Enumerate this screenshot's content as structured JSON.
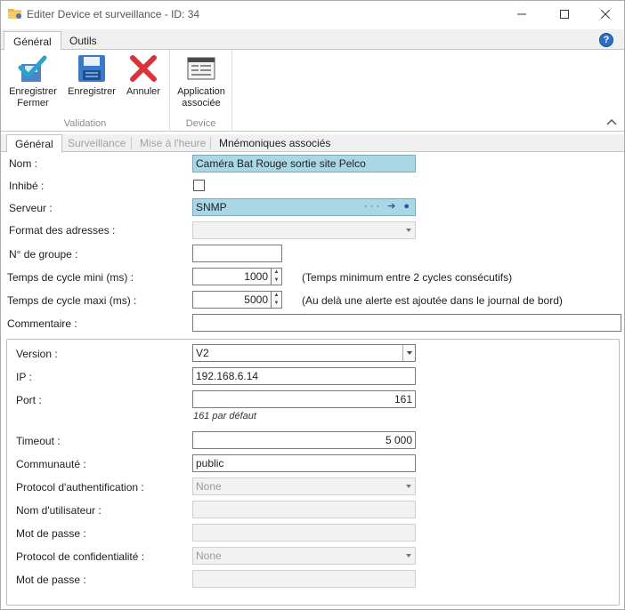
{
  "window": {
    "title": "Editer Device et surveillance - ID: 34"
  },
  "ribbon": {
    "tabs": [
      "Général",
      "Outils"
    ],
    "groups": {
      "validation_label": "Validation",
      "device_label": "Device"
    },
    "buttons": {
      "save_close": "Enregistrer Fermer",
      "save": "Enregistrer",
      "cancel": "Annuler",
      "linked_app": "Application associée"
    }
  },
  "tabs": [
    "Général",
    "Surveillance",
    "Mise à l'heure",
    "Mnémoniques associés"
  ],
  "form": {
    "nom": {
      "label": "Nom :",
      "value": "Caméra Bat Rouge sortie site Pelco"
    },
    "inhibe": {
      "label": "Inhibé :",
      "checked": false
    },
    "serveur": {
      "label": "Serveur :",
      "value": "SNMP",
      "icons": "··· ➔ ●"
    },
    "format_adresses": {
      "label": "Format des adresses :",
      "value": ""
    },
    "num_groupe": {
      "label": "N° de groupe :",
      "value": ""
    },
    "cycle_mini": {
      "label": "Temps de cycle mini (ms) :",
      "value": "1000",
      "hint": "(Temps minimum entre 2 cycles consécutifs)"
    },
    "cycle_maxi": {
      "label": "Temps de cycle maxi (ms) :",
      "value": "5000",
      "hint": "(Au delà une alerte est ajoutée dans le journal de bord)"
    },
    "commentaire": {
      "label": "Commentaire :",
      "value": ""
    }
  },
  "snmp": {
    "version": {
      "label": "Version :",
      "value": "V2"
    },
    "ip": {
      "label": "IP :",
      "value": "192.168.6.14"
    },
    "port": {
      "label": "Port :",
      "value": "161",
      "hint": "161 par défaut"
    },
    "timeout": {
      "label": "Timeout :",
      "value": "5 000"
    },
    "communaute": {
      "label": "Communauté :",
      "value": "public"
    },
    "auth_protocol": {
      "label": "Protocol d'authentification :",
      "value": "None"
    },
    "username": {
      "label": "Nom d'utilisateur :",
      "value": ""
    },
    "password1": {
      "label": "Mot de passe :",
      "value": ""
    },
    "privacy_protocol": {
      "label": "Protocol de confidentialité :",
      "value": "None"
    },
    "password2": {
      "label": "Mot de passe :",
      "value": ""
    }
  },
  "colors": {
    "highlight_field": "#a9d7e6",
    "save_close_check": "#2aa3c9",
    "cancel_x": "#d9343a",
    "save_disk": "#3a7bc8"
  }
}
